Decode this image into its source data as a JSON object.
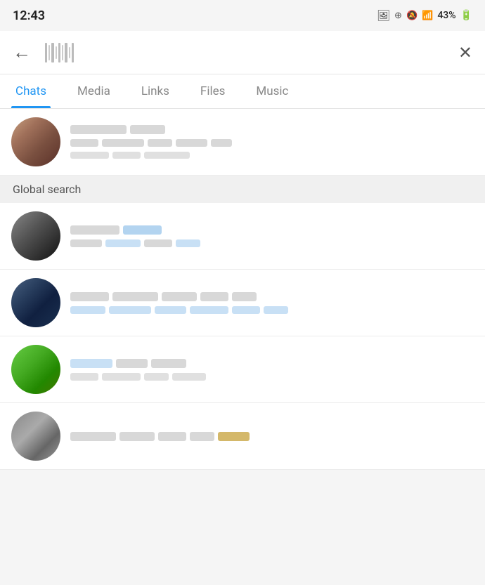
{
  "statusBar": {
    "time": "12:43",
    "battery": "43%"
  },
  "topNav": {
    "backLabel": "←",
    "closeLabel": "✕"
  },
  "tabs": [
    {
      "id": "chats",
      "label": "Chats",
      "active": true
    },
    {
      "id": "media",
      "label": "Media",
      "active": false
    },
    {
      "id": "links",
      "label": "Links",
      "active": false
    },
    {
      "id": "files",
      "label": "Files",
      "active": false
    },
    {
      "id": "music",
      "label": "Music",
      "active": false
    }
  ],
  "sectionHeader": "Global search",
  "chatItems": [
    {
      "id": 1,
      "avatarClass": "avatar-1"
    },
    {
      "id": 2,
      "avatarClass": "avatar-2"
    },
    {
      "id": 3,
      "avatarClass": "avatar-3"
    },
    {
      "id": 4,
      "avatarClass": "avatar-4"
    },
    {
      "id": 5,
      "avatarClass": "avatar-5"
    }
  ]
}
